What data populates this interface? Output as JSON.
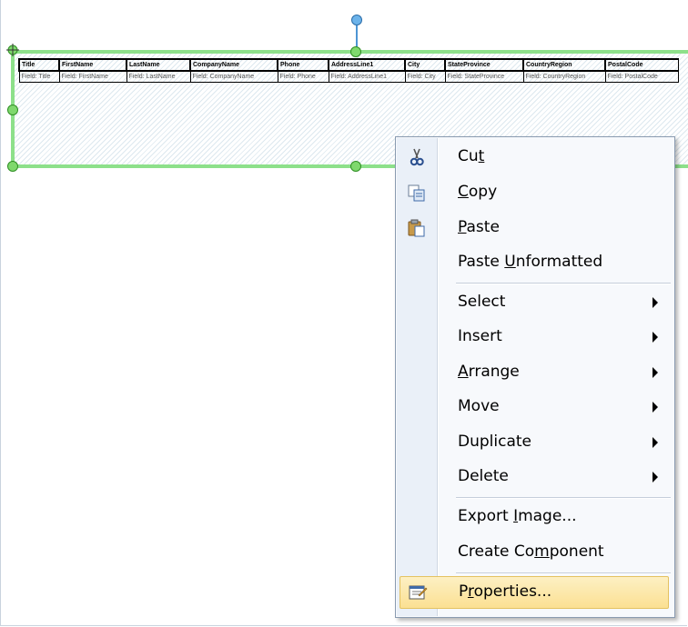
{
  "table": {
    "headers": [
      "Title",
      "FirstName",
      "LastName",
      "CompanyName",
      "Phone",
      "AddressLine1",
      "City",
      "StateProvince",
      "CountryRegion",
      "PostalCode"
    ],
    "fields": [
      "Field: Title",
      "Field: FirstName",
      "Field: LastName",
      "Field: CompanyName",
      "Field: Phone",
      "Field: AddressLine1",
      "Field: City",
      "Field: StateProvince",
      "Field: CountryRegion",
      "Field: PostalCode"
    ]
  },
  "menu": {
    "items": [
      {
        "label": "Cut",
        "mnemonic": "t",
        "icon": "scissors-icon"
      },
      {
        "label": "Copy",
        "mnemonic": "C",
        "icon": "copy-icon"
      },
      {
        "label": "Paste",
        "mnemonic": "P",
        "icon": "paste-icon"
      },
      {
        "label": "Paste Unformatted",
        "mnemonic": "U"
      },
      {
        "label": "Select",
        "submenu": true
      },
      {
        "label": "Insert",
        "submenu": true
      },
      {
        "label": "Arrange",
        "mnemonic": "A",
        "submenu": true
      },
      {
        "label": "Move",
        "submenu": true
      },
      {
        "label": "Duplicate",
        "submenu": true
      },
      {
        "label": "Delete",
        "submenu": true
      },
      {
        "label": "Export Image...",
        "mnemonic": "I"
      },
      {
        "label": "Create Component",
        "mnemonic": "m"
      },
      {
        "label": "Properties...",
        "mnemonic": "r",
        "icon": "properties-icon",
        "highlighted": true
      }
    ]
  },
  "colors": {
    "selection_handle": "#7fd86d",
    "rotation_handle": "#6cb3ea",
    "menu_highlight": "#fbe093"
  }
}
